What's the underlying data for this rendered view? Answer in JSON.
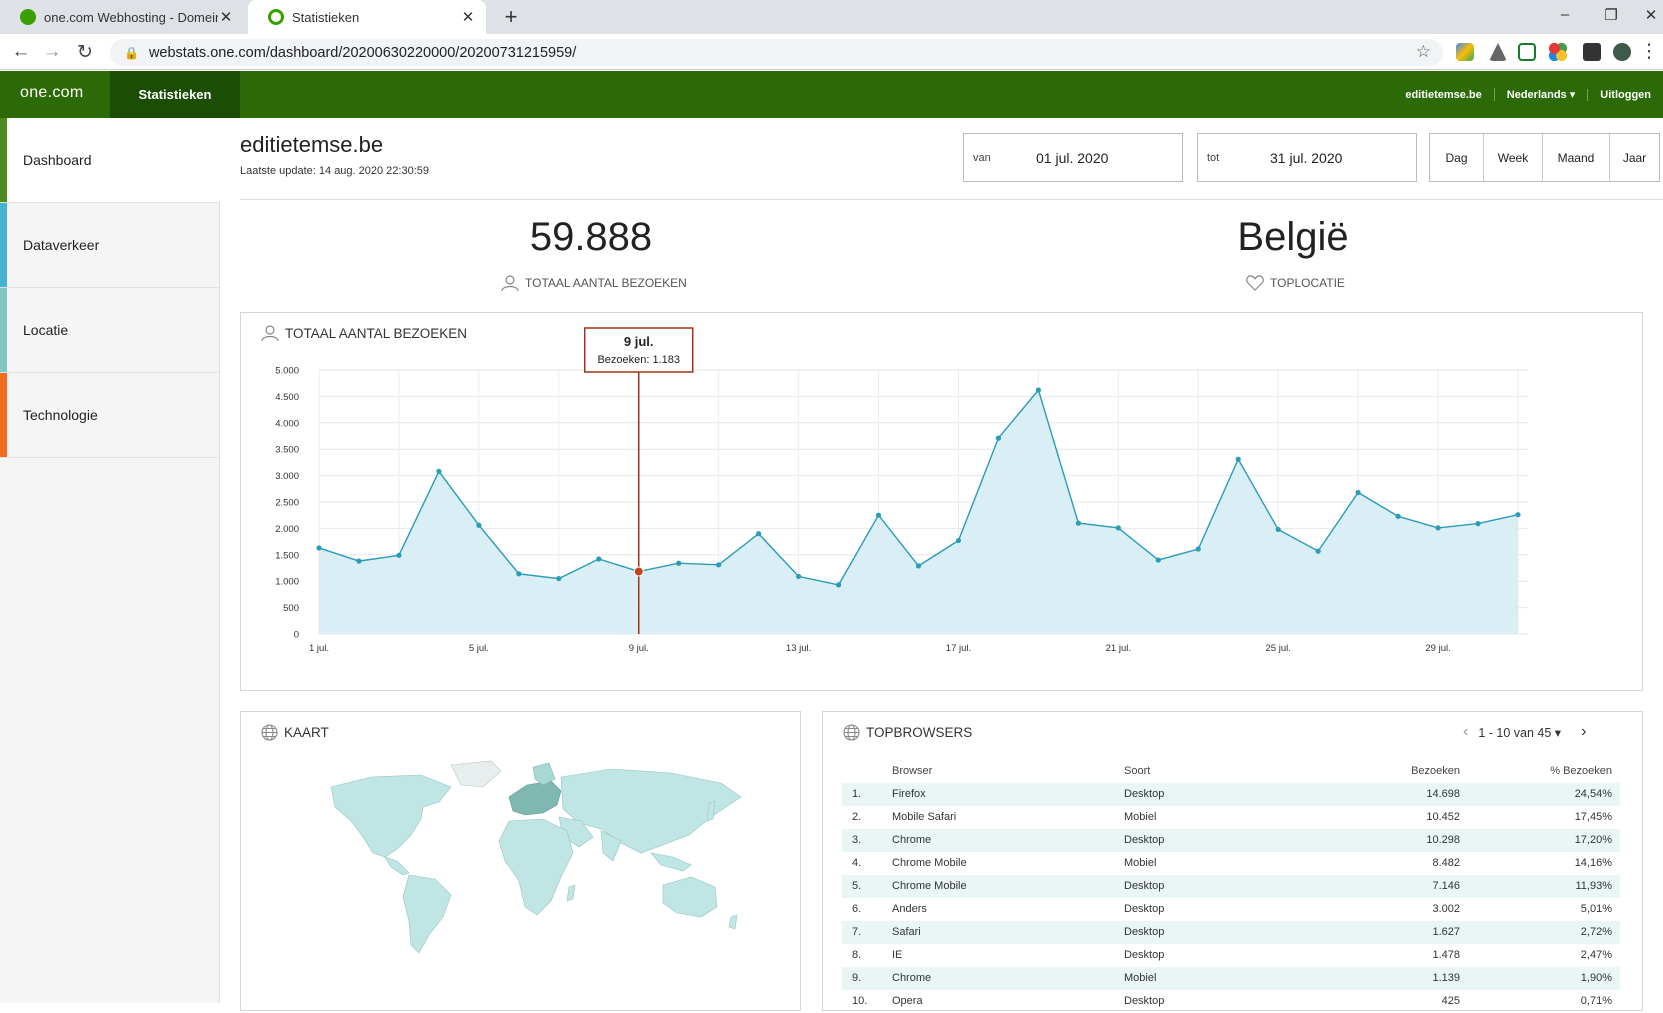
{
  "browser": {
    "tabs": [
      {
        "title": "one.com Webhosting - Domeinnaam",
        "active": false,
        "color": "#3aa000"
      },
      {
        "title": "Statistieken",
        "active": true,
        "color": "#ffffff"
      }
    ],
    "url": "webstats.one.com/dashboard/20200630220000/20200731215959/"
  },
  "header": {
    "brand": "one.com",
    "nav_active": "Statistieken",
    "domain": "editietemse.be",
    "language": "Nederlands",
    "logout": "Uitloggen",
    "colors": {
      "bar": "#2c6a07",
      "active": "#1b4d05"
    }
  },
  "sidebar": {
    "items": [
      {
        "label": "Dashboard",
        "color": "#4c8a1c"
      },
      {
        "label": "Dataverkeer",
        "color": "#46b3d2"
      },
      {
        "label": "Locatie",
        "color": "#7fc7c0"
      },
      {
        "label": "Technologie",
        "color": "#f26c21"
      }
    ]
  },
  "main": {
    "site": "editietemse.be",
    "last_update": "Laatste update: 14 aug. 2020 22:30:59",
    "from_label": "van",
    "from_value": "01 jul. 2020",
    "to_label": "tot",
    "to_value": "31 jul. 2020",
    "periods": [
      "Dag",
      "Week",
      "Maand",
      "Jaar"
    ]
  },
  "kpis": {
    "visits_value": "59.888",
    "visits_label": "TOTAAL AANTAL BEZOEKEN",
    "location_value": "België",
    "location_label": "TOPLOCATIE"
  },
  "chart_card": {
    "title": "TOTAAL AANTAL BEZOEKEN",
    "tooltip_title": "9 jul.",
    "tooltip_text": "Bezoeken: 1.183"
  },
  "chart_data": {
    "type": "area",
    "x": [
      "1 jul.",
      "2 jul.",
      "3 jul.",
      "4 jul.",
      "5 jul.",
      "6 jul.",
      "7 jul.",
      "8 jul.",
      "9 jul.",
      "10 jul.",
      "11 jul.",
      "12 jul.",
      "13 jul.",
      "14 jul.",
      "15 jul.",
      "16 jul.",
      "17 jul.",
      "18 jul.",
      "19 jul.",
      "20 jul.",
      "21 jul.",
      "22 jul.",
      "23 jul.",
      "24 jul.",
      "25 jul.",
      "26 jul.",
      "27 jul.",
      "28 jul.",
      "29 jul.",
      "30 jul.",
      "31 jul."
    ],
    "values": [
      1630,
      1380,
      1490,
      3080,
      2060,
      1140,
      1050,
      1420,
      1183,
      1340,
      1310,
      1900,
      1090,
      930,
      2250,
      1290,
      1770,
      3710,
      4620,
      2100,
      2010,
      1400,
      1610,
      3310,
      1980,
      1570,
      2680,
      2230,
      2010,
      2090,
      2260
    ],
    "xticks": [
      "1 jul.",
      "5 jul.",
      "9 jul.",
      "13 jul.",
      "17 jul.",
      "21 jul.",
      "25 jul.",
      "29 jul."
    ],
    "yticks": [
      "0",
      "500",
      "1.000",
      "1.500",
      "2.000",
      "2.500",
      "3.000",
      "3.500",
      "4.000",
      "4.500",
      "5.000"
    ],
    "ylim": [
      0,
      5000
    ],
    "highlight": "9 jul.",
    "grid": true,
    "colors": {
      "line": "#2a9cb6",
      "fill": "#d7eef4",
      "highlight": "#c1421c",
      "tooltip": "#a0321c"
    }
  },
  "map_card": {
    "title": "KAART"
  },
  "browsers_card": {
    "title": "TOPBROWSERS",
    "pager": "1 - 10 van 45",
    "columns": [
      "Browser",
      "Soort",
      "Bezoeken",
      "% Bezoeken"
    ],
    "rows": [
      {
        "rank": "1.",
        "browser": "Firefox",
        "type": "Desktop",
        "visits": "14.698",
        "pct": "24,54%"
      },
      {
        "rank": "2.",
        "browser": "Mobile Safari",
        "type": "Mobiel",
        "visits": "10.452",
        "pct": "17,45%"
      },
      {
        "rank": "3.",
        "browser": "Chrome",
        "type": "Desktop",
        "visits": "10.298",
        "pct": "17,20%"
      },
      {
        "rank": "4.",
        "browser": "Chrome Mobile",
        "type": "Mobiel",
        "visits": "8.482",
        "pct": "14,16%"
      },
      {
        "rank": "5.",
        "browser": "Chrome Mobile",
        "type": "Desktop",
        "visits": "7.146",
        "pct": "11,93%"
      },
      {
        "rank": "6.",
        "browser": "Anders",
        "type": "Desktop",
        "visits": "3.002",
        "pct": "5,01%"
      },
      {
        "rank": "7.",
        "browser": "Safari",
        "type": "Desktop",
        "visits": "1.627",
        "pct": "2,72%"
      },
      {
        "rank": "8.",
        "browser": "IE",
        "type": "Desktop",
        "visits": "1.478",
        "pct": "2,47%"
      },
      {
        "rank": "9.",
        "browser": "Chrome",
        "type": "Mobiel",
        "visits": "1.139",
        "pct": "1,90%"
      },
      {
        "rank": "10.",
        "browser": "Opera",
        "type": "Desktop",
        "visits": "425",
        "pct": "0,71%"
      }
    ]
  }
}
